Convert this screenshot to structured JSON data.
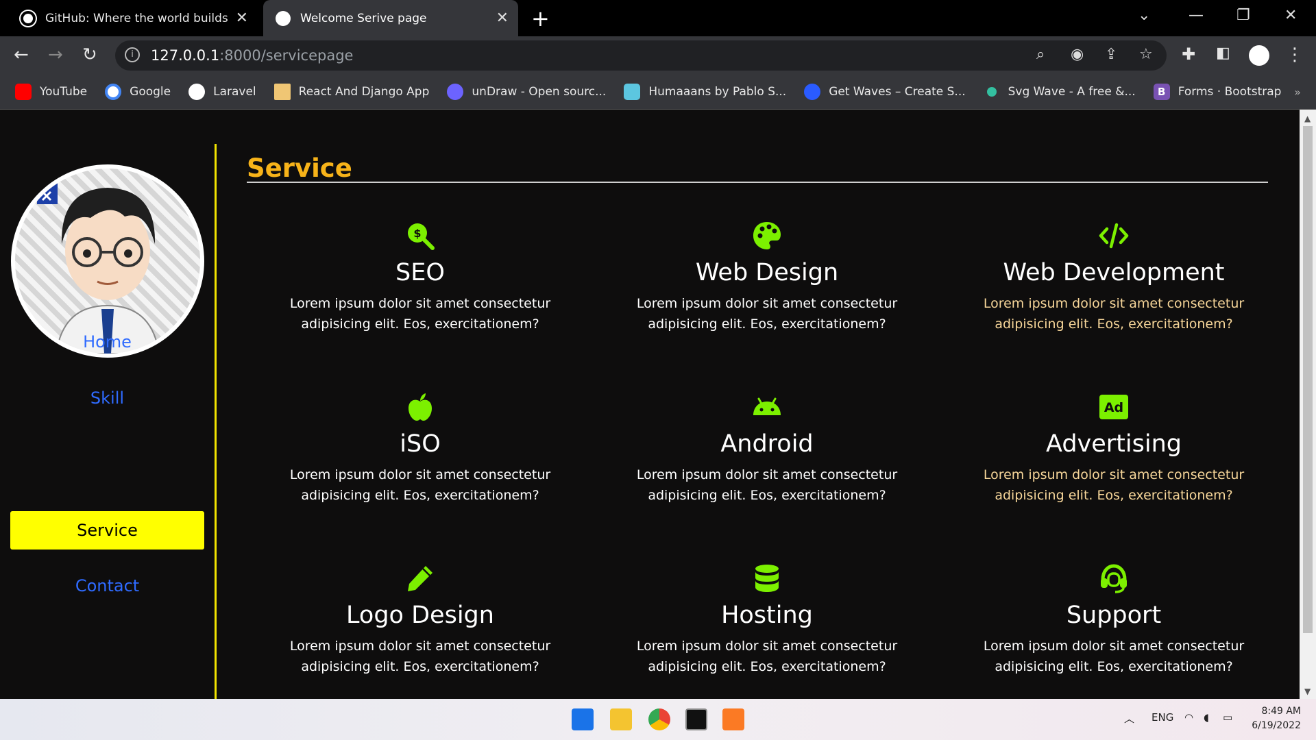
{
  "browser": {
    "tabs": [
      {
        "title": "GitHub: Where the world builds soft",
        "active": false
      },
      {
        "title": "Welcome Serive page",
        "active": true
      }
    ],
    "address": {
      "host": "127.0.0.1",
      "path": ":8000/servicepage"
    },
    "bookmarks": [
      {
        "label": "YouTube",
        "color": "#ff0000"
      },
      {
        "label": "Google",
        "color": "#4285f4"
      },
      {
        "label": "Laravel",
        "color": "#ffffff"
      },
      {
        "label": "React And Django App",
        "color": "#f0c674"
      },
      {
        "label": "unDraw - Open sourc...",
        "color": "#6c63ff"
      },
      {
        "label": "Humaaans by Pablo S...",
        "color": "#5cc6e0"
      },
      {
        "label": "Get Waves – Create S...",
        "color": "#2a5bff"
      },
      {
        "label": "Svg Wave - A free &...",
        "color": "#33c0a0"
      },
      {
        "label": "Forms · Bootstrap",
        "color": "#7952b3"
      }
    ]
  },
  "sidebar": {
    "nav": [
      {
        "label": "Home",
        "active": false
      },
      {
        "label": "Skill",
        "active": false
      },
      {
        "label": "Service",
        "active": true
      },
      {
        "label": "Contact",
        "active": false
      }
    ]
  },
  "main": {
    "section_title": "Service",
    "cards": [
      {
        "icon": "seo-icon",
        "title": "SEO",
        "desc": "Lorem ipsum dolor sit amet consectetur adipisicing elit. Eos, exercitationem?"
      },
      {
        "icon": "palette-icon",
        "title": "Web Design",
        "desc": "Lorem ipsum dolor sit amet consectetur adipisicing elit. Eos, exercitationem?"
      },
      {
        "icon": "code-icon",
        "title": "Web Development",
        "desc": "Lorem ipsum dolor sit amet consectetur adipisicing elit. Eos, exercitationem?"
      },
      {
        "icon": "apple-icon",
        "title": "iSO",
        "desc": "Lorem ipsum dolor sit amet consectetur adipisicing elit. Eos, exercitationem?"
      },
      {
        "icon": "android-icon",
        "title": "Android",
        "desc": "Lorem ipsum dolor sit amet consectetur adipisicing elit. Eos, exercitationem?"
      },
      {
        "icon": "ad-icon",
        "title": "Advertising",
        "desc": "Lorem ipsum dolor sit amet consectetur adipisicing elit. Eos, exercitationem?"
      },
      {
        "icon": "pencil-icon",
        "title": "Logo Design",
        "desc": "Lorem ipsum dolor sit amet consectetur adipisicing elit. Eos, exercitationem?"
      },
      {
        "icon": "database-icon",
        "title": "Hosting",
        "desc": "Lorem ipsum dolor sit amet consectetur adipisicing elit. Eos, exercitationem?"
      },
      {
        "icon": "headset-icon",
        "title": "Support",
        "desc": "Lorem ipsum dolor sit amet consectetur adipisicing elit. Eos, exercitationem?"
      }
    ]
  },
  "colors": {
    "accent_green": "#7cf000",
    "title_orange": "#f7b319",
    "nav_blue": "#2f6bff",
    "active_yellow": "#ffff00"
  },
  "taskbar": {
    "lang": "ENG",
    "time": "8:49 AM",
    "date": "6/19/2022"
  }
}
